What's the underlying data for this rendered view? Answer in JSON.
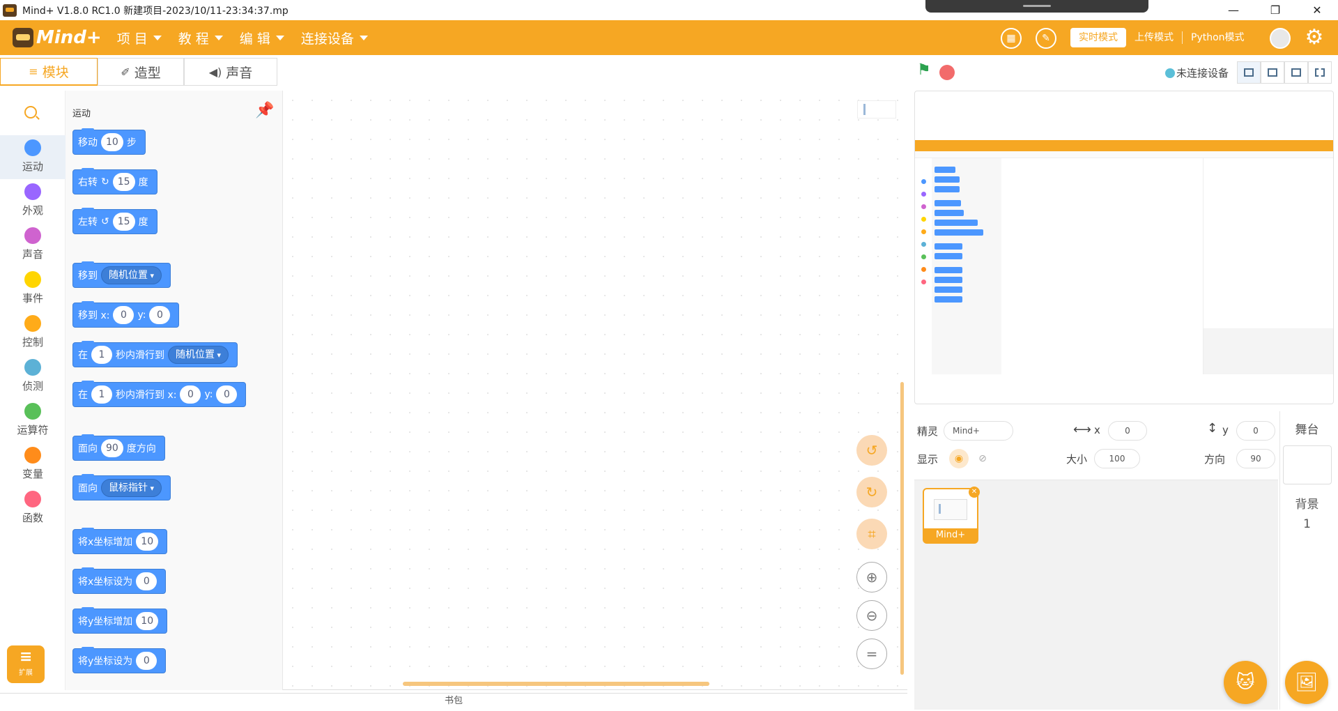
{
  "window": {
    "title": "Mind+ V1.8.0 RC1.0    新建项目-2023/10/11-23:34:37.mp"
  },
  "window_controls": {
    "minimize": "—",
    "maximize": "❐",
    "close": "✕"
  },
  "logo": {
    "text": "Mind+"
  },
  "menu": [
    {
      "label": "项 目"
    },
    {
      "label": "教 程"
    },
    {
      "label": "编 辑"
    },
    {
      "label": "连接设备"
    }
  ],
  "modes": [
    {
      "label": "实时模式",
      "active": true
    },
    {
      "label": "上传模式",
      "active": false
    },
    {
      "label": "Python模式",
      "active": false
    }
  ],
  "editor_tabs": [
    {
      "label": "模块",
      "icon": "code-icon"
    },
    {
      "label": "造型",
      "icon": "brush-icon"
    },
    {
      "label": "声音",
      "icon": "speaker-icon"
    }
  ],
  "connection": {
    "status": "未连接设备"
  },
  "categories": [
    {
      "label": "运动",
      "color": "#4c97ff"
    },
    {
      "label": "外观",
      "color": "#9966ff"
    },
    {
      "label": "声音",
      "color": "#cf63cf"
    },
    {
      "label": "事件",
      "color": "#ffd500"
    },
    {
      "label": "控制",
      "color": "#ffab19"
    },
    {
      "label": "侦测",
      "color": "#5cb1d6"
    },
    {
      "label": "运算符",
      "color": "#59c059"
    },
    {
      "label": "变量",
      "color": "#ff8c1a"
    },
    {
      "label": "函数",
      "color": "#ff6680"
    }
  ],
  "extension_button": {
    "label": "扩展"
  },
  "palette": {
    "title": "运动",
    "blocks": {
      "move": {
        "label": "移动",
        "value": "10",
        "suffix": "步"
      },
      "turn_right": {
        "label": "右转",
        "value": "15",
        "suffix": "度"
      },
      "turn_left": {
        "label": "左转",
        "value": "15",
        "suffix": "度"
      },
      "goto": {
        "label": "移到",
        "dropdown": "随机位置"
      },
      "goto_xy": {
        "label": "移到 x:",
        "x": "0",
        "y_label": "y:",
        "y": "0"
      },
      "glide_to": {
        "prefix": "在",
        "seconds": "1",
        "label": "秒内滑行到",
        "dropdown": "随机位置"
      },
      "glide_xy": {
        "prefix": "在",
        "seconds": "1",
        "label": "秒内滑行到 x:",
        "x": "0",
        "y_label": "y:",
        "y": "0"
      },
      "point_dir": {
        "label": "面向",
        "value": "90",
        "suffix": "度方向"
      },
      "point_towards": {
        "label": "面向",
        "dropdown": "鼠标指针"
      },
      "change_x": {
        "label": "将x坐标增加",
        "value": "10"
      },
      "set_x": {
        "label": "将x坐标设为",
        "value": "0"
      },
      "change_y": {
        "label": "将y坐标增加",
        "value": "10"
      },
      "set_y": {
        "label": "将y坐标设为",
        "value": "0"
      }
    }
  },
  "backpack": {
    "label": "书包"
  },
  "sprite_info": {
    "sprite_label": "精灵",
    "sprite_name": "Mind+",
    "x_label": "x",
    "x": "0",
    "y_label": "y",
    "y": "0",
    "show_label": "显示",
    "size_label": "大小",
    "size": "100",
    "direction_label": "方向",
    "direction": "90"
  },
  "sprites": [
    {
      "name": "Mind+"
    }
  ],
  "stage_pane": {
    "title": "舞台",
    "backdrop_label": "背景",
    "backdrop_count": "1"
  },
  "colors": {
    "accent": "#f6a723",
    "motion": "#4c97ff"
  }
}
